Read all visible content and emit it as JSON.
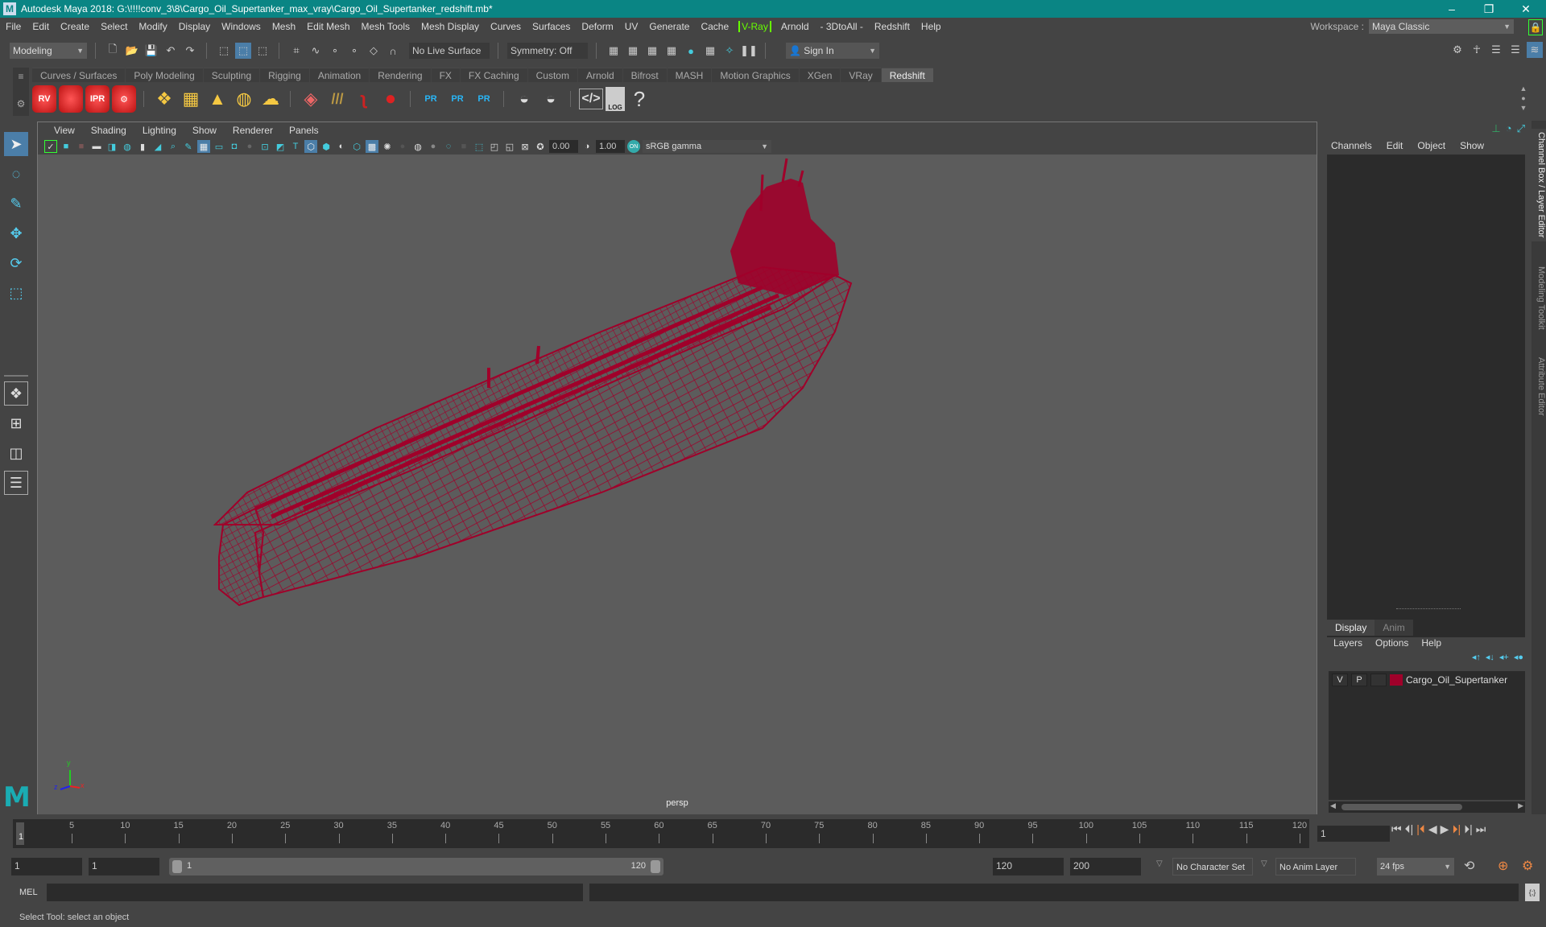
{
  "window": {
    "title": "Autodesk Maya 2018: G:\\!!!!conv_3\\8\\Cargo_Oil_Supertanker_max_vray\\Cargo_Oil_Supertanker_redshift.mb*",
    "logo": "M",
    "controls": {
      "minimize": "–",
      "maximize": "❐",
      "close": "✕"
    }
  },
  "menubar": {
    "items": [
      "File",
      "Edit",
      "Create",
      "Select",
      "Modify",
      "Display",
      "Windows",
      "Mesh",
      "Edit Mesh",
      "Mesh Tools",
      "Mesh Display",
      "Curves",
      "Surfaces",
      "Deform",
      "UV",
      "Generate",
      "Cache",
      "V-Ray",
      "Arnold",
      "- 3DtoAll -",
      "Redshift",
      "Help"
    ],
    "workspace_label": "Workspace :",
    "workspace_value": "Maya Classic"
  },
  "statusline": {
    "mode": "Modeling",
    "live_surface": "No Live Surface",
    "symmetry": "Symmetry: Off",
    "sign_in": "Sign In"
  },
  "shelf": {
    "tabs": [
      "Curves / Surfaces",
      "Poly Modeling",
      "Sculpting",
      "Rigging",
      "Animation",
      "Rendering",
      "FX",
      "FX Caching",
      "Custom",
      "Arnold",
      "Bifrost",
      "MASH",
      "Motion Graphics",
      "XGen",
      "VRay",
      "Redshift"
    ],
    "active_tab": "Redshift",
    "icons": [
      {
        "name": "redshift-render-view-icon",
        "label": "RV"
      },
      {
        "name": "redshift-batch-render-icon",
        "label": ""
      },
      {
        "name": "redshift-ipr-icon",
        "label": "IPR"
      },
      {
        "name": "redshift-settings-icon",
        "label": ""
      },
      {
        "name": "redshift-light-rect-icon",
        "label": ""
      },
      {
        "name": "redshift-light-portal-icon",
        "label": ""
      },
      {
        "name": "redshift-light-ies-icon",
        "label": ""
      },
      {
        "name": "redshift-dome-light-icon",
        "label": ""
      },
      {
        "name": "redshift-sun-sky-icon",
        "label": ""
      },
      {
        "name": "redshift-proxy-icon",
        "label": ""
      },
      {
        "name": "redshift-hair-icon",
        "label": ""
      },
      {
        "name": "redshift-volume-icon",
        "label": ""
      },
      {
        "name": "redshift-sphere-icon",
        "label": ""
      },
      {
        "name": "pr-object-icon",
        "label": "PR"
      },
      {
        "name": "pr-export-icon",
        "label": "PR"
      },
      {
        "name": "pr-convert-icon",
        "label": "PR"
      },
      {
        "name": "bake-pie-1-icon",
        "label": ""
      },
      {
        "name": "bake-pie-2-icon",
        "label": ""
      },
      {
        "name": "script-editor-icon",
        "label": ""
      },
      {
        "name": "log-icon",
        "label": "LOG"
      },
      {
        "name": "help-icon",
        "label": "?"
      }
    ]
  },
  "viewport": {
    "menus": [
      "View",
      "Shading",
      "Lighting",
      "Show",
      "Renderer",
      "Panels"
    ],
    "exposure": "0.00",
    "gamma": "1.00",
    "color_space": "sRGB gamma",
    "camera": "persp",
    "wire_color": "#a0002a",
    "axis": {
      "x": "x",
      "y": "y",
      "z": "z"
    }
  },
  "channel_box": {
    "menus": [
      "Channels",
      "Edit",
      "Object",
      "Show"
    ],
    "side_tabs": [
      "Channel Box / Layer Editor",
      "Modeling Toolkit",
      "Attribute Editor"
    ]
  },
  "layer_editor": {
    "tabs": [
      "Display",
      "Anim"
    ],
    "active_tab": "Display",
    "menus": [
      "Layers",
      "Options",
      "Help"
    ],
    "layers": [
      {
        "visible": "V",
        "playback": "P",
        "color": "#a0002a",
        "name": "Cargo_Oil_Supertanker"
      }
    ]
  },
  "timeline": {
    "ticks": [
      "5",
      "10",
      "15",
      "20",
      "25",
      "30",
      "35",
      "40",
      "45",
      "50",
      "55",
      "60",
      "65",
      "70",
      "75",
      "80",
      "85",
      "90",
      "95",
      "100",
      "105",
      "110",
      "115",
      "120"
    ],
    "start_marker": "1",
    "current_frame": "1"
  },
  "range": {
    "start": "1",
    "playback_start": "1",
    "slider_start": "1",
    "slider_end": "120",
    "playback_end": "120",
    "end": "200",
    "character_set": "No Character Set",
    "anim_layer": "No Anim Layer",
    "fps": "24 fps"
  },
  "command_line": {
    "label": "MEL",
    "value": ""
  },
  "help_line": "Select Tool: select an object"
}
